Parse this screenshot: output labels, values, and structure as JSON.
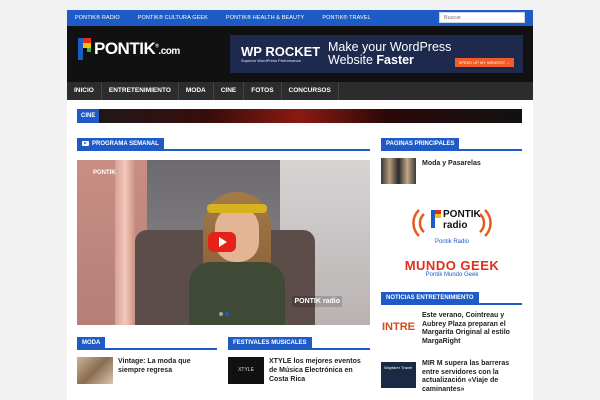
{
  "topbar": {
    "links": [
      "PONTIK® RADIO",
      "PONTIK® CULTURA GEEK",
      "PONTIK® HEALTH & BEAUTY",
      "PONTIK® TRAVEL"
    ],
    "search_placeholder": "Buscar"
  },
  "logo": {
    "name": "PONTIK",
    "suffix": ".com",
    "mark": "®"
  },
  "ad": {
    "brand": "WP ROCKET",
    "sub": "Superior WordPress Performance",
    "headline_1": "Make your WordPress",
    "headline_2a": "Website ",
    "headline_2b": "Faster",
    "cta": "SPEED UP MY WEBSITE →"
  },
  "nav": [
    "INICIO",
    "ENTRETENIMIENTO",
    "MODA",
    "CINE",
    "FOTOS",
    "CONCURSOS"
  ],
  "cine_label": "CINE",
  "programa": {
    "title": "PROGRAMA SEMANAL"
  },
  "video": {
    "logo": "PONTIK",
    "logo2": "PONTIK radio"
  },
  "moda": {
    "title": "MODA",
    "post": "Vintage: La moda que siempre regresa"
  },
  "festivales": {
    "title": "FESTIVALES MUSICALES",
    "post": "XTYLE los mejores eventos de Música Electrónica en Costa Rica",
    "thumb_text": "XTYLE"
  },
  "paginas": {
    "title": "PAGINAS PRINCIPALES",
    "item": "Moda y Pasarelas",
    "radio_logo": "PONTIK radio",
    "radio_caption": "Pontik Radio",
    "geek_logo": "MUNDO GEEK",
    "geek_caption": "Pontik Mundo Geek"
  },
  "noticias": {
    "title": "NOTICIAS ENTRETENIMIENTO",
    "items": [
      {
        "thumb": "INTRE",
        "text": "Este verano, Cointreau y Aubrey Plaza preparan el Margarita Original al estilo MargaRight"
      },
      {
        "thumb": "Wayfarer Travel",
        "text": "MIR M supera las barreras entre servidores con la actualización «Viaje de caminantes»"
      }
    ]
  },
  "colors": {
    "accent": "#1e5bc6",
    "header_bg": "#111111",
    "nav_bg": "#2c2c2c"
  }
}
